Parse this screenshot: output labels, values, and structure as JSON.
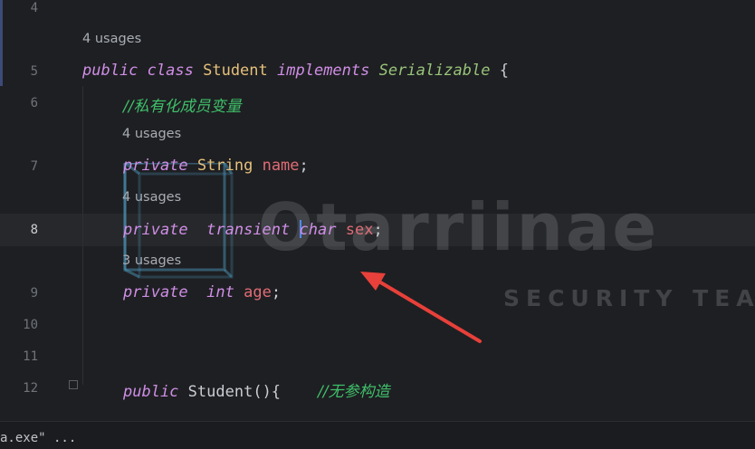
{
  "gutter": {
    "line_numbers": [
      "4",
      "5",
      "6",
      "7",
      "8",
      "9",
      "10",
      "11",
      "12"
    ],
    "current_line": "8"
  },
  "hints": {
    "class_usages": "4 usages",
    "name_usages": "4 usages",
    "sex_usages": "4 usages",
    "age_usages": "3 usages"
  },
  "code": {
    "line5": {
      "public": "public",
      "class": "class",
      "name": "Student",
      "implements": "implements",
      "iface": "Serializable",
      "brace": "{"
    },
    "line6": {
      "comment": "//私有化成员变量"
    },
    "line7": {
      "private": "private",
      "type": "String",
      "field": "name",
      "semi": ";"
    },
    "line8": {
      "private": "private",
      "transient": "transient",
      "type": "char",
      "field": "sex",
      "semi": ";"
    },
    "line9": {
      "private": "private",
      "type": "int",
      "field": "age",
      "semi": ";"
    },
    "line12": {
      "public": "public",
      "ctor": "Student",
      "parens": "(){",
      "comment": "//无参构造"
    }
  },
  "watermark": {
    "title": "Otarriinae",
    "subtitle": "SECURITY TEAM"
  },
  "bottom_bar": {
    "text": "a.exe\" ..."
  },
  "colors": {
    "background": "#1e1f22",
    "keyword": "#cf8ee6",
    "type": "#e5c07b",
    "interface": "#98c379",
    "field": "#e06c75",
    "comment": "#3fbf6a",
    "caret": "#4e8cff",
    "arrow": "#e8403a"
  }
}
